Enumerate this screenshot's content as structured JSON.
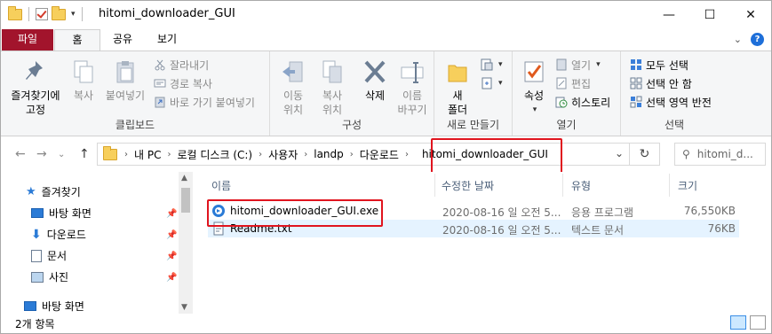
{
  "window": {
    "title": "hitomi_downloader_GUI"
  },
  "window_controls": {
    "minimize": "—",
    "maximize": "☐",
    "close": "✕"
  },
  "ribbon_tabs": {
    "file": "파일",
    "home": "홈",
    "share": "공유",
    "view": "보기"
  },
  "clipboard": {
    "pin": "즐겨찾기에\n고정",
    "copy": "복사",
    "paste": "붙여넣기",
    "cut": "잘라내기",
    "copy_path": "경로 복사",
    "paste_shortcut": "바로 가기 붙여넣기",
    "label": "클립보드"
  },
  "organize": {
    "move_to": "이동\n위치",
    "copy_to": "복사\n위치",
    "delete": "삭제",
    "rename": "이름\n바꾸기",
    "label": "구성"
  },
  "new": {
    "new_folder": "새\n폴더",
    "label": "새로 만들기"
  },
  "open": {
    "properties": "속성",
    "open": "열기",
    "edit": "편집",
    "history": "히스토리",
    "label": "열기"
  },
  "select": {
    "select_all": "모두 선택",
    "select_none": "선택 안 함",
    "invert": "선택 영역 반전",
    "label": "선택"
  },
  "address": {
    "crumbs": [
      "내 PC",
      "로컬 디스크 (C:)",
      "사용자",
      "landp",
      "다운로드",
      "hitomi_downloader_GUI"
    ]
  },
  "search": {
    "placeholder": "hitomi_d..."
  },
  "sidebar": {
    "items": [
      {
        "label": "즐겨찾기"
      },
      {
        "label": "바탕 화면"
      },
      {
        "label": "다운로드"
      },
      {
        "label": "문서"
      },
      {
        "label": "사진"
      },
      {
        "label": "바탕 화면"
      }
    ]
  },
  "columns": {
    "name": "이름",
    "modified": "수정한 날짜",
    "type": "유형",
    "size": "크기"
  },
  "files": [
    {
      "name": "hitomi_downloader_GUI.exe",
      "modified": "2020-08-16 일 오전 5...",
      "type": "응용 프로그램",
      "size": "76,550KB"
    },
    {
      "name": "Readme.txt",
      "modified": "2020-08-16 일 오전 5...",
      "type": "텍스트 문서",
      "size": "76KB"
    }
  ],
  "status": {
    "count": "2개 항목"
  },
  "colors": {
    "accent": "#a2142c",
    "highlight": "#e0141e",
    "selection": "#cce8ff"
  }
}
